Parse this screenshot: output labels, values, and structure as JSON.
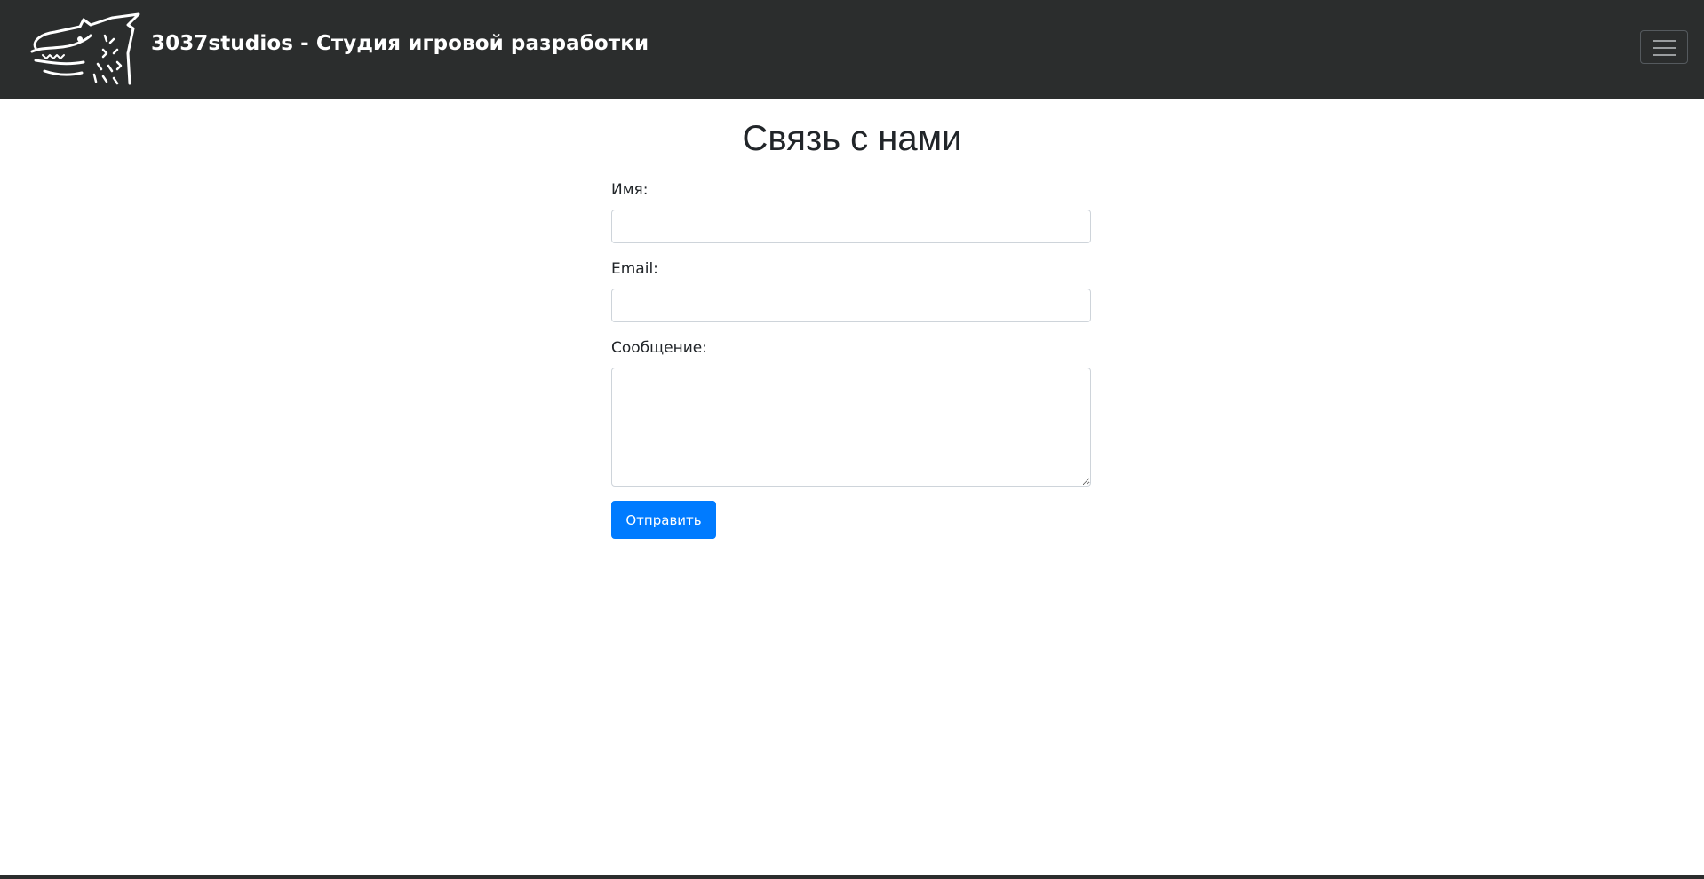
{
  "header": {
    "brand": "3037studios - Студия игровой разработки",
    "logo_icon": "wolf-head-logo",
    "menu_icon": "hamburger-menu-icon",
    "background_color": "#2b2d2d"
  },
  "main": {
    "title": "Связь с нами",
    "form": {
      "name_label": "Имя:",
      "name_value": "",
      "email_label": "Email:",
      "email_value": "",
      "message_label": "Сообщение:",
      "message_value": "",
      "submit_label": "Отправить"
    }
  },
  "colors": {
    "primary_button": "#007bff",
    "text": "#212529",
    "input_border": "#ced4da"
  }
}
